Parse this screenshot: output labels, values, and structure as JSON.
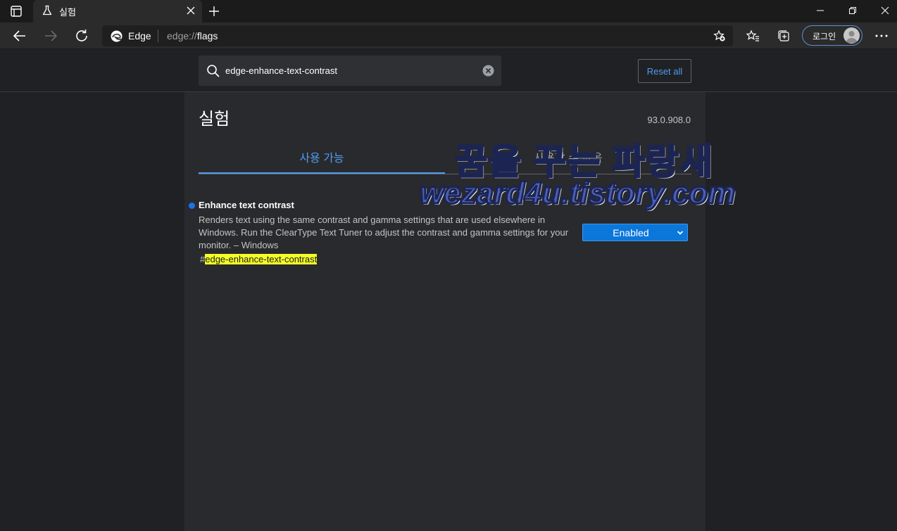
{
  "browser": {
    "tab": {
      "title": "실험"
    },
    "address": {
      "brand": "Edge",
      "url_prefix": "edge://",
      "url_path": "flags"
    },
    "profile": {
      "login_label": "로그인"
    }
  },
  "flags": {
    "search": {
      "value": "edge-enhance-text-contrast"
    },
    "reset_label": "Reset all",
    "title": "실험",
    "version": "93.0.908.0",
    "tabs": [
      {
        "label": "사용 가능",
        "active": true
      },
      {
        "label": "사용할 수 없음",
        "active": false
      }
    ],
    "experiment": {
      "title": "Enhance text contrast",
      "description": "Renders text using the same contrast and gamma settings that are used elsewhere in Windows. Run the ClearType Text Tuner to adjust the contrast and gamma settings for your monitor. – Windows",
      "hash": "#",
      "link": "edge-enhance-text-contrast",
      "state": "Enabled"
    }
  },
  "watermark": {
    "line1": "꿈을 꾸는 파랑새",
    "line2": "wezard4u.tistory.com"
  },
  "colors": {
    "accent": "#4f9cf0",
    "select_bg": "#0b77db",
    "highlight": "#f4ff27"
  },
  "icons": [
    "tab-actions-icon",
    "flask-icon",
    "close-icon",
    "plus-icon",
    "minimize-icon",
    "restore-icon",
    "back-icon",
    "forward-icon",
    "refresh-icon",
    "edge-logo-icon",
    "add-favorite-icon",
    "favorites-icon",
    "collections-icon",
    "more-icon",
    "search-icon",
    "clear-icon",
    "chevron-down-icon"
  ]
}
